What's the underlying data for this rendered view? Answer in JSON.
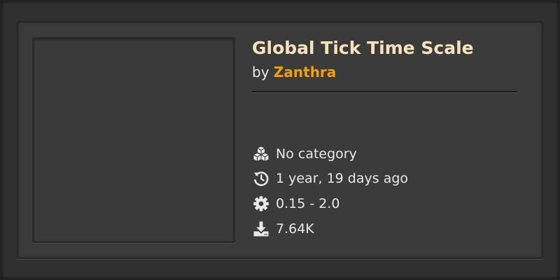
{
  "mod": {
    "title": "Global Tick Time Scale",
    "by_label": "by",
    "author": "Zanthra"
  },
  "meta": {
    "category": "No category",
    "updated": "1 year, 19 days ago",
    "versions": "0.15 - 2.0",
    "downloads": "7.64K"
  },
  "icons": {
    "category": "cubes-icon",
    "updated": "history-icon",
    "versions": "gear-icon",
    "downloads": "download-icon"
  },
  "colors": {
    "title": "#f6e2bd",
    "author": "#f59e0b",
    "text": "#e8e8e8",
    "card_bg": "#3b3b3b"
  }
}
